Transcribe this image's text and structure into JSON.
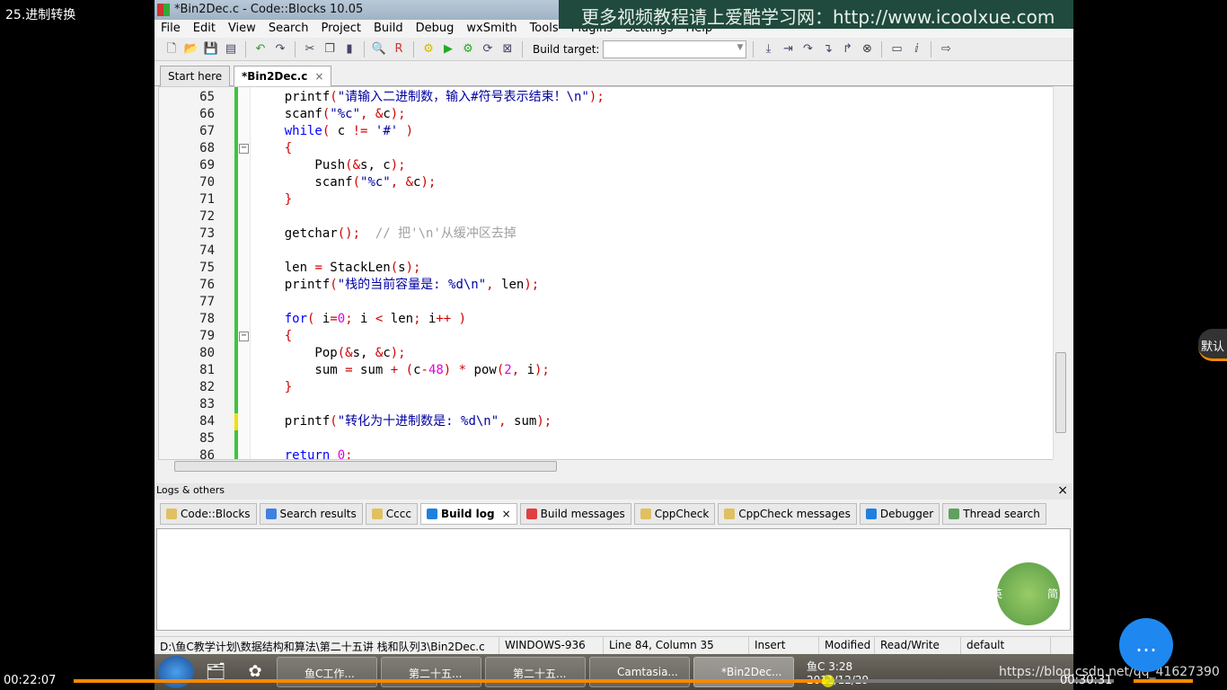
{
  "video": {
    "title": "25.进制转换",
    "current_time": "00:22:07",
    "duration": "00:30:31",
    "progress": 0.725,
    "url_watermark": "https://blog.csdn.net/qq_41627390",
    "default_button": "默认",
    "chat_icon": "chat-bubble-icon",
    "accent": "#f58a00"
  },
  "window": {
    "title": "*Bin2Dec.c - Code::Blocks 10.05",
    "banner": "更多视频教程请上爱酷学习网：http://www.icoolxue.com"
  },
  "menu": [
    "File",
    "Edit",
    "View",
    "Search",
    "Project",
    "Build",
    "Debug",
    "wxSmith",
    "Tools",
    "Plugins",
    "Settings",
    "Help"
  ],
  "toolbar": {
    "build_target_label": "Build target:",
    "build_target_value": ""
  },
  "editor_tabs": [
    {
      "label": "Start here"
    },
    {
      "label": "*Bin2Dec.c",
      "close": "×"
    }
  ],
  "code": [
    {
      "n": "65",
      "t": [
        [
          "t",
          "    printf"
        ],
        [
          "o",
          "("
        ],
        [
          "s",
          "\"请输入二进制数，输入#符号表示结束！\\n\""
        ],
        [
          "o",
          ");"
        ]
      ]
    },
    {
      "n": "66",
      "t": [
        [
          "t",
          "    scanf"
        ],
        [
          "o",
          "("
        ],
        [
          "s",
          "\"%c\""
        ],
        [
          "o",
          ", &"
        ],
        [
          "t",
          "c"
        ],
        [
          "o",
          ");"
        ]
      ]
    },
    {
      "n": "67",
      "t": [
        [
          "k",
          "    while"
        ],
        [
          "o",
          "("
        ],
        [
          "t",
          " c "
        ],
        [
          "o",
          "!="
        ],
        [
          "t",
          " "
        ],
        [
          "s",
          "'#'"
        ],
        [
          "t",
          " "
        ],
        [
          "o",
          ")"
        ]
      ]
    },
    {
      "n": "68",
      "t": [
        [
          "o",
          "    {"
        ]
      ],
      "fold": "−"
    },
    {
      "n": "69",
      "t": [
        [
          "t",
          "        Push"
        ],
        [
          "o",
          "(&"
        ],
        [
          "t",
          "s, c"
        ],
        [
          "o",
          ");"
        ]
      ]
    },
    {
      "n": "70",
      "t": [
        [
          "t",
          "        scanf"
        ],
        [
          "o",
          "("
        ],
        [
          "s",
          "\"%c\""
        ],
        [
          "o",
          ", &"
        ],
        [
          "t",
          "c"
        ],
        [
          "o",
          ");"
        ]
      ]
    },
    {
      "n": "71",
      "t": [
        [
          "o",
          "    }"
        ]
      ]
    },
    {
      "n": "72",
      "t": []
    },
    {
      "n": "73",
      "t": [
        [
          "t",
          "    getchar"
        ],
        [
          "o",
          "();"
        ],
        [
          "t",
          "  "
        ],
        [
          "c",
          "// 把'\\n'从缓冲区去掉"
        ]
      ]
    },
    {
      "n": "74",
      "t": []
    },
    {
      "n": "75",
      "t": [
        [
          "t",
          "    len "
        ],
        [
          "o",
          "="
        ],
        [
          "t",
          " StackLen"
        ],
        [
          "o",
          "("
        ],
        [
          "t",
          "s"
        ],
        [
          "o",
          ");"
        ]
      ]
    },
    {
      "n": "76",
      "t": [
        [
          "t",
          "    printf"
        ],
        [
          "o",
          "("
        ],
        [
          "s",
          "\"栈的当前容量是: %d\\n\""
        ],
        [
          "o",
          ","
        ],
        [
          "t",
          " len"
        ],
        [
          "o",
          ");"
        ]
      ]
    },
    {
      "n": "77",
      "t": []
    },
    {
      "n": "78",
      "t": [
        [
          "k",
          "    for"
        ],
        [
          "o",
          "("
        ],
        [
          "t",
          " i"
        ],
        [
          "o",
          "="
        ],
        [
          "n",
          "0"
        ],
        [
          "o",
          ";"
        ],
        [
          "t",
          " i "
        ],
        [
          "o",
          "<"
        ],
        [
          "t",
          " len"
        ],
        [
          "o",
          ";"
        ],
        [
          "t",
          " i"
        ],
        [
          "o",
          "++"
        ],
        [
          "t",
          " "
        ],
        [
          "o",
          ")"
        ]
      ]
    },
    {
      "n": "79",
      "t": [
        [
          "o",
          "    {"
        ]
      ],
      "fold": "−"
    },
    {
      "n": "80",
      "t": [
        [
          "t",
          "        Pop"
        ],
        [
          "o",
          "(&"
        ],
        [
          "t",
          "s, "
        ],
        [
          "o",
          "&"
        ],
        [
          "t",
          "c"
        ],
        [
          "o",
          ");"
        ]
      ]
    },
    {
      "n": "81",
      "t": [
        [
          "t",
          "        sum "
        ],
        [
          "o",
          "="
        ],
        [
          "t",
          " sum "
        ],
        [
          "o",
          "+"
        ],
        [
          "t",
          " "
        ],
        [
          "o",
          "("
        ],
        [
          "t",
          "c"
        ],
        [
          "o",
          "-"
        ],
        [
          "n",
          "48"
        ],
        [
          "o",
          ")"
        ],
        [
          "t",
          " "
        ],
        [
          "o",
          "*"
        ],
        [
          "t",
          " pow"
        ],
        [
          "o",
          "("
        ],
        [
          "n",
          "2"
        ],
        [
          "o",
          ","
        ],
        [
          "t",
          " i"
        ],
        [
          "o",
          ");"
        ]
      ]
    },
    {
      "n": "82",
      "t": [
        [
          "o",
          "    }"
        ]
      ]
    },
    {
      "n": "83",
      "t": []
    },
    {
      "n": "84",
      "t": [
        [
          "t",
          "    printf"
        ],
        [
          "o",
          "("
        ],
        [
          "s",
          "\"转化为十进制数是: %d\\n\""
        ],
        [
          "o",
          ","
        ],
        [
          "t",
          " sum"
        ],
        [
          "o",
          ");"
        ]
      ]
    },
    {
      "n": "85",
      "t": []
    },
    {
      "n": "86",
      "t": [
        [
          "k",
          "    return"
        ],
        [
          "t",
          " "
        ],
        [
          "n",
          "0"
        ],
        [
          "o",
          ";"
        ]
      ]
    }
  ],
  "logs": {
    "header": "Logs & others",
    "close": "×",
    "tabs": [
      {
        "label": "Code::Blocks",
        "color": "#e0c060"
      },
      {
        "label": "Search results",
        "color": "#4080e0"
      },
      {
        "label": "Cccc",
        "color": "#e0c060"
      },
      {
        "label": "Build log",
        "color": "#2080e0",
        "active": true,
        "close": "×"
      },
      {
        "label": "Build messages",
        "color": "#e04040"
      },
      {
        "label": "CppCheck",
        "color": "#e0c060"
      },
      {
        "label": "CppCheck messages",
        "color": "#e0c060"
      },
      {
        "label": "Debugger",
        "color": "#2080e0"
      },
      {
        "label": "Thread search",
        "color": "#60a060"
      }
    ]
  },
  "status": [
    "D:\\鱼C教学计划\\数据结构和算法\\第二十五讲 栈和队列3\\Bin2Dec.c",
    "WINDOWS-936",
    "Line 84, Column 35",
    "Insert",
    "Modified",
    "Read/Write",
    "default"
  ],
  "taskbar": {
    "tasks": [
      {
        "label": "鱼C工作..."
      },
      {
        "label": "第二十五..."
      },
      {
        "label": "第二十五..."
      },
      {
        "label": "Camtasia..."
      },
      {
        "label": "*Bin2Dec...",
        "active": true
      }
    ],
    "clock": "鱼C 3:28",
    "date": "2011/12/29"
  },
  "ime": {
    "en": "英",
    "jian": "简"
  }
}
